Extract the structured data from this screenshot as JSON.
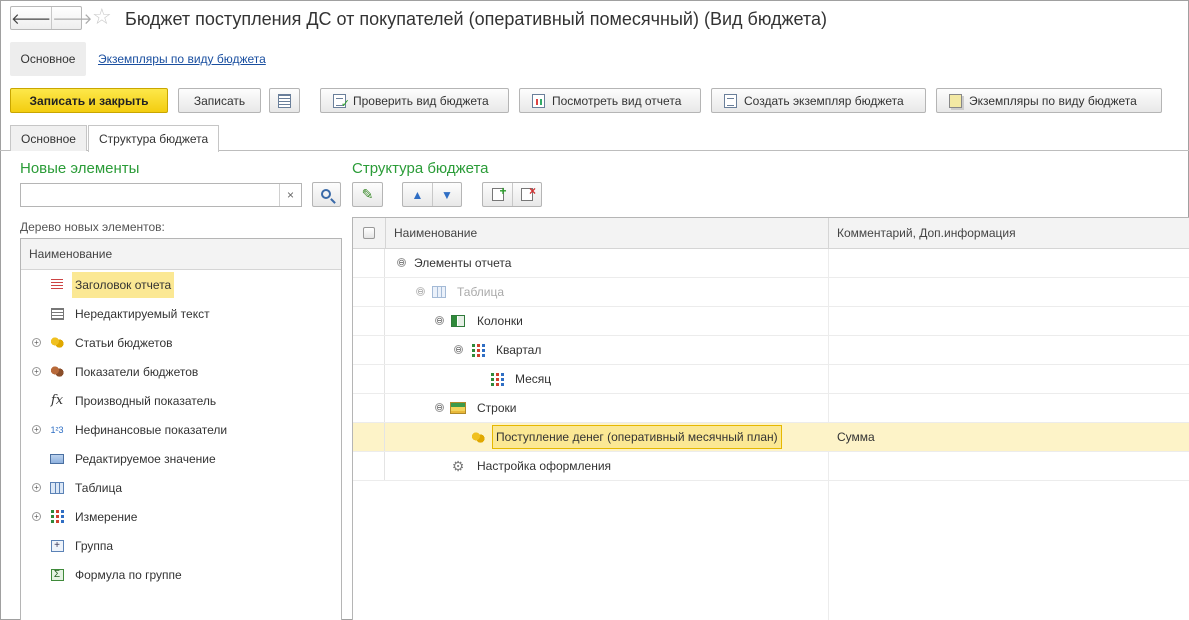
{
  "window": {
    "title": "Бюджет  поступления ДС от покупателей (оперативный помесячный)  (Вид бюджета)",
    "back_glyph": "🡐",
    "forward_glyph": "🡒",
    "star_glyph": "☆"
  },
  "top_tabs": {
    "main": "Основное",
    "instances_link": "Экземпляры по виду бюджета"
  },
  "toolbar": {
    "save_close": "Записать и закрыть",
    "save": "Записать",
    "check": "Проверить вид бюджета",
    "view_report": "Посмотреть вид отчета",
    "create_instance": "Создать экземпляр бюджета",
    "instances": "Экземпляры по виду бюджета"
  },
  "inner_tabs": {
    "main": "Основное",
    "structure": "Структура бюджета"
  },
  "left": {
    "title": "Новые элементы",
    "search": {
      "value": "",
      "clear_glyph": "×"
    },
    "tree_caption": "Дерево новых элементов:",
    "column_header": "Наименование",
    "items": [
      {
        "label": "Заголовок отчета",
        "icon": "report-header-icon",
        "expandable": false,
        "selected": true
      },
      {
        "label": "Нередактируемый текст",
        "icon": "text-icon",
        "expandable": false,
        "selected": false
      },
      {
        "label": "Статьи бюджетов",
        "icon": "coins-icon",
        "expandable": true,
        "selected": false
      },
      {
        "label": "Показатели бюджетов",
        "icon": "coins-brown-icon",
        "expandable": true,
        "selected": false
      },
      {
        "label": "Производный показатель",
        "icon": "fx-icon",
        "expandable": false,
        "selected": false
      },
      {
        "label": "Нефинансовые показатели",
        "icon": "numbers-icon",
        "expandable": true,
        "selected": false
      },
      {
        "label": "Редактируемое значение",
        "icon": "edit-value-icon",
        "expandable": false,
        "selected": false
      },
      {
        "label": "Таблица",
        "icon": "table-icon",
        "expandable": true,
        "selected": false
      },
      {
        "label": "Измерение",
        "icon": "dimension-icon",
        "expandable": true,
        "selected": false
      },
      {
        "label": "Группа",
        "icon": "group-icon",
        "expandable": false,
        "selected": false
      },
      {
        "label": "Формула по группе",
        "icon": "sigma-icon",
        "expandable": false,
        "selected": false
      }
    ]
  },
  "right": {
    "title": "Структура бюджета",
    "columns": [
      "Наименование",
      "Комментарий, Доп.информация"
    ],
    "rows": [
      {
        "label": "Элементы отчета",
        "comment": "",
        "icon": "",
        "expander": "⊖",
        "dim": false,
        "selected": false
      },
      {
        "label": "Таблица",
        "comment": "",
        "icon": "table-icon",
        "expander": "⊖",
        "dim": true,
        "selected": false
      },
      {
        "label": "Колонки",
        "comment": "",
        "icon": "columns-icon",
        "expander": "⊖",
        "dim": false,
        "selected": false
      },
      {
        "label": "Квартал",
        "comment": "",
        "icon": "dimension-icon",
        "expander": "⊖",
        "dim": false,
        "selected": false
      },
      {
        "label": "Месяц",
        "comment": "",
        "icon": "dimension-icon",
        "expander": "",
        "dim": false,
        "selected": false
      },
      {
        "label": "Строки",
        "comment": "",
        "icon": "rows-icon",
        "expander": "⊖",
        "dim": false,
        "selected": false
      },
      {
        "label": "Поступление денег (оперативный месячный план)",
        "comment": "Сумма",
        "icon": "coins-icon",
        "expander": "",
        "dim": false,
        "selected": true
      },
      {
        "label": "Настройка оформления",
        "comment": "",
        "icon": "gear-icon",
        "expander": "",
        "dim": false,
        "selected": false
      }
    ]
  }
}
